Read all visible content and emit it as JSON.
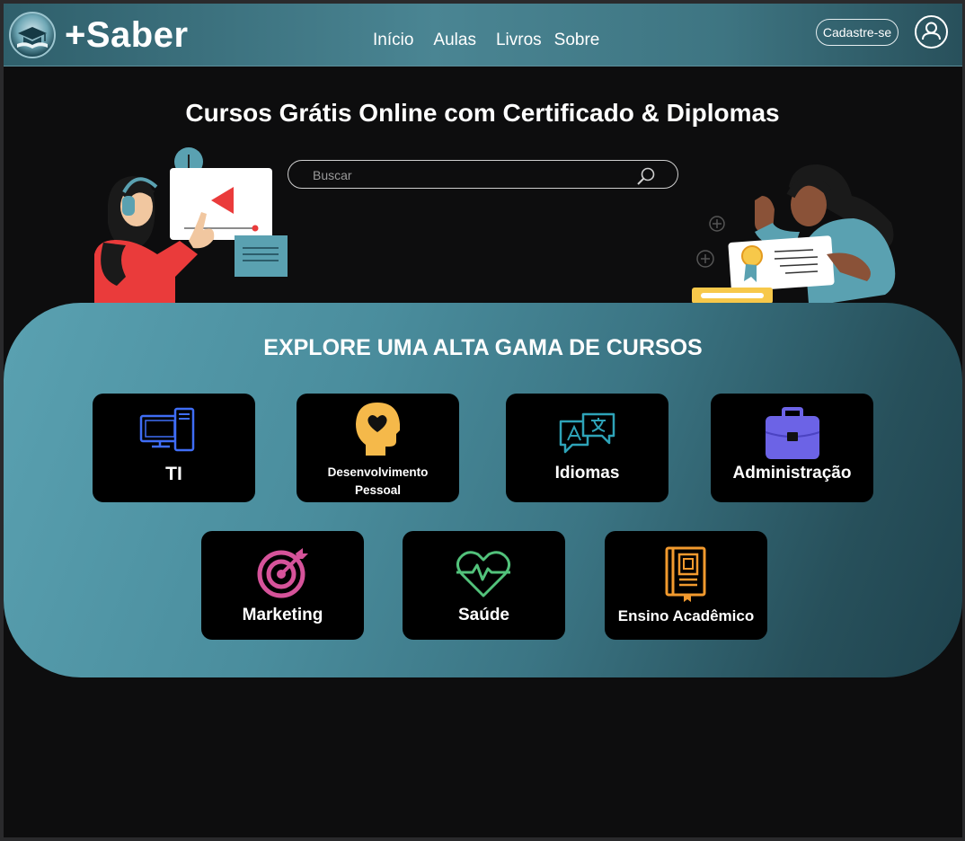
{
  "header": {
    "brand": "+Saber",
    "nav": [
      "Início",
      "Aulas",
      "Livros",
      "Sobre"
    ],
    "signup_label": "Cadastre-se"
  },
  "hero": {
    "title": "Cursos Grátis Online com Certificado & Diplomas",
    "search_placeholder": "Buscar"
  },
  "courses": {
    "title": "EXPLORE UMA ALTA GAMA DE CURSOS",
    "items": [
      {
        "label": "TI",
        "icon": "computer-icon",
        "color": "#3f6df5"
      },
      {
        "label": "Desenvolvimento Pessoal",
        "icon": "head-heart-icon",
        "color": "#f5b94a"
      },
      {
        "label": "Idiomas",
        "icon": "translate-icon",
        "color": "#2ea3b8"
      },
      {
        "label": "Administração",
        "icon": "briefcase-icon",
        "color": "#6c63e6"
      },
      {
        "label": "Marketing",
        "icon": "target-icon",
        "color": "#d6539a"
      },
      {
        "label": "Saúde",
        "icon": "heart-pulse-icon",
        "color": "#52c27b"
      },
      {
        "label": "Ensino Acadêmico",
        "icon": "book-icon",
        "color": "#f29a2e"
      }
    ]
  }
}
